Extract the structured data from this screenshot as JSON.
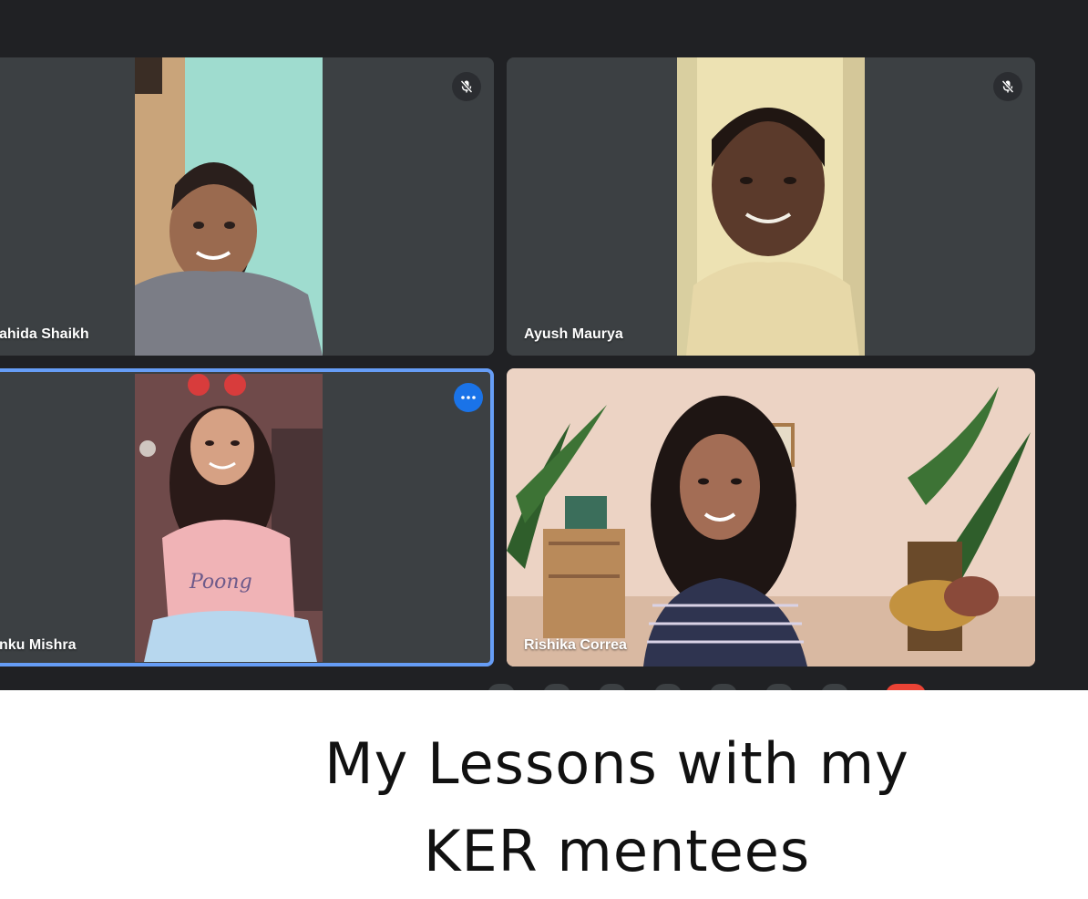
{
  "participants": [
    {
      "name": "ahida Shaikh",
      "mic_icon": "mic-off-icon"
    },
    {
      "name": "Ayush Maurya",
      "mic_icon": "mic-off-icon"
    },
    {
      "name": "nku Mishra",
      "menu_icon": "more-options-icon"
    },
    {
      "name": "Rishika Correa"
    }
  ],
  "caption": {
    "line1": "My Lessons with my",
    "line2": "KER mentees"
  },
  "colors": {
    "background": "#202124",
    "tile": "#3c4043",
    "active_border": "#669df6",
    "more_button": "#1a73e8"
  }
}
